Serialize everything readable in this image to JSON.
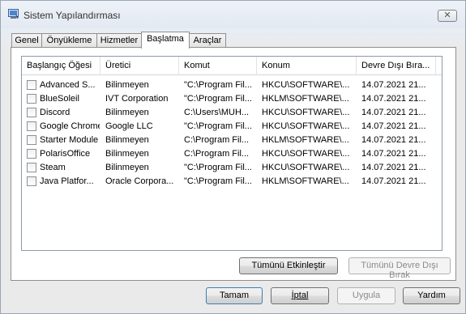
{
  "window": {
    "title": "Sistem Yapılandırması",
    "close_glyph": "✕"
  },
  "tabs": [
    {
      "label": "Genel",
      "active": false
    },
    {
      "label": "Önyükleme",
      "active": false
    },
    {
      "label": "Hizmetler",
      "active": false
    },
    {
      "label": "Başlatma",
      "active": true
    },
    {
      "label": "Araçlar",
      "active": false
    }
  ],
  "startup_list": {
    "columns": [
      "Başlangıç Öğesi",
      "Üretici",
      "Komut",
      "Konum",
      "Devre Dışı Bıra..."
    ],
    "rows": [
      {
        "item": "Advanced S...",
        "manufacturer": "Bilinmeyen",
        "command": "\"C:\\Program Fil...",
        "location": "HKCU\\SOFTWARE\\...",
        "disabled": "14.07.2021 21...",
        "checked": false
      },
      {
        "item": "BlueSoleil",
        "manufacturer": "IVT Corporation",
        "command": "\"C:\\Program Fil...",
        "location": "HKLM\\SOFTWARE\\...",
        "disabled": "14.07.2021 21...",
        "checked": false
      },
      {
        "item": "Discord",
        "manufacturer": "Bilinmeyen",
        "command": "C:\\Users\\MUH...",
        "location": "HKCU\\SOFTWARE\\...",
        "disabled": "14.07.2021 21...",
        "checked": false
      },
      {
        "item": "Google Chrome",
        "manufacturer": "Google LLC",
        "command": "\"C:\\Program Fil...",
        "location": "HKCU\\SOFTWARE\\...",
        "disabled": "14.07.2021 21...",
        "checked": false
      },
      {
        "item": "Starter Module",
        "manufacturer": "Bilinmeyen",
        "command": "C:\\Program Fil...",
        "location": "HKLM\\SOFTWARE\\...",
        "disabled": "14.07.2021 21...",
        "checked": false
      },
      {
        "item": "PolarisOffice",
        "manufacturer": "Bilinmeyen",
        "command": "C:\\Program Fil...",
        "location": "HKCU\\SOFTWARE\\...",
        "disabled": "14.07.2021 21...",
        "checked": false
      },
      {
        "item": "Steam",
        "manufacturer": "Bilinmeyen",
        "command": "\"C:\\Program Fil...",
        "location": "HKCU\\SOFTWARE\\...",
        "disabled": "14.07.2021 21...",
        "checked": false
      },
      {
        "item": "Java Platfor...",
        "manufacturer": "Oracle Corpora...",
        "command": "\"C:\\Program Fil...",
        "location": "HKLM\\SOFTWARE\\...",
        "disabled": "14.07.2021 21...",
        "checked": false
      }
    ]
  },
  "panel_buttons": {
    "enable_all": "Tümünü Etkinleştir",
    "disable_all": "Tümünü Devre Dışı Bırak"
  },
  "footer_buttons": {
    "ok": "Tamam",
    "cancel": "İptal",
    "apply": "Uygula",
    "help": "Yardım"
  }
}
